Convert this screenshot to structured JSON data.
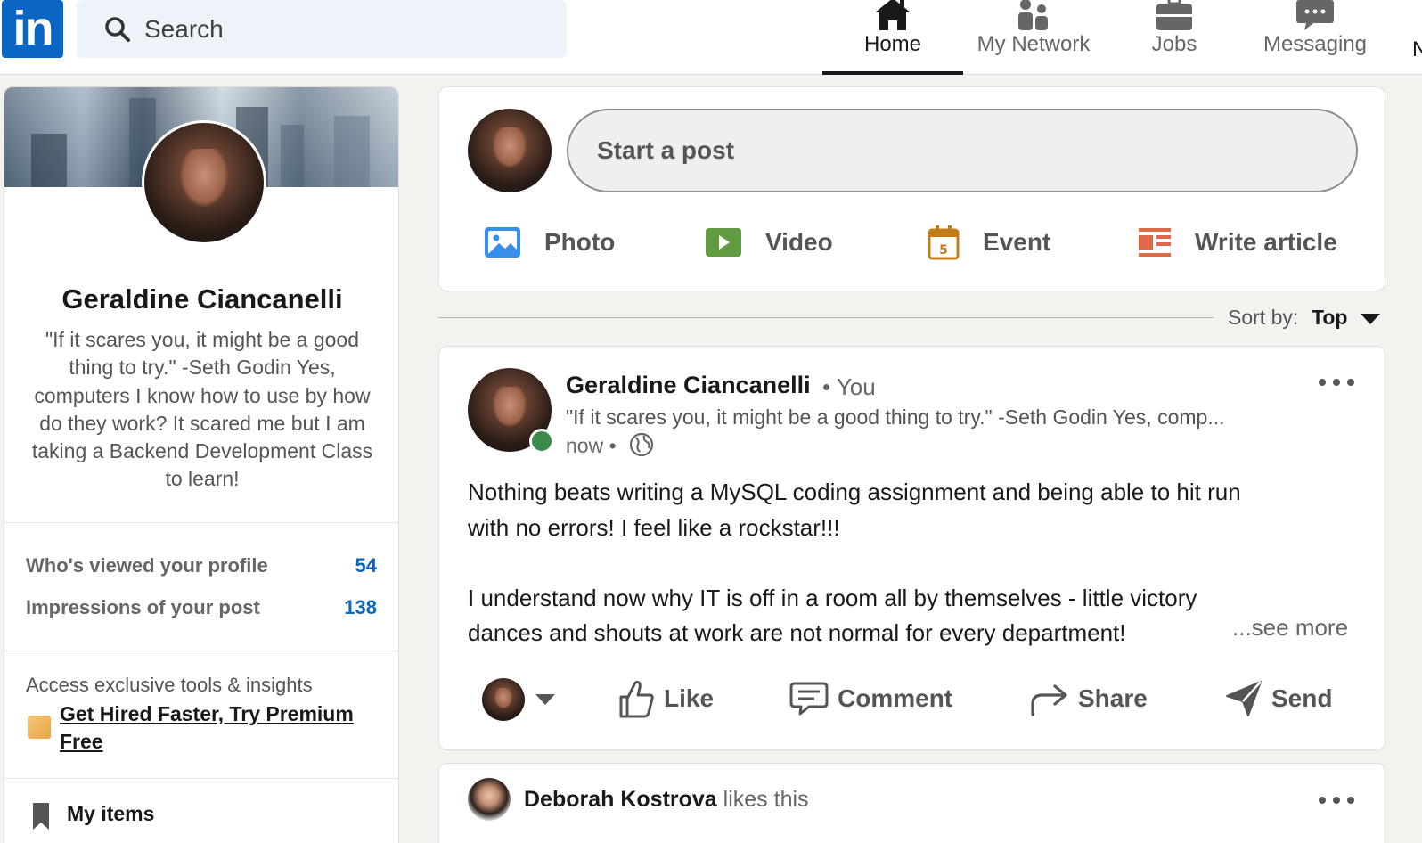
{
  "header": {
    "logo_text": "in",
    "search_placeholder": "Search",
    "nav": [
      {
        "label": "Home",
        "icon": "home-icon",
        "active": true
      },
      {
        "label": "My Network",
        "icon": "network-icon"
      },
      {
        "label": "Jobs",
        "icon": "briefcase-icon"
      },
      {
        "label": "Messaging",
        "icon": "chat-bubble-icon"
      }
    ],
    "nav_overflow": "N"
  },
  "profile": {
    "name": "Geraldine Ciancanelli",
    "headline": "\"If it scares you, it might be a good thing to try.\" -Seth Godin Yes, computers I know how to use by how do they work? It scared me but I am taking a Backend Development Class to learn!",
    "stats": [
      {
        "label": "Who's viewed your profile",
        "value": "54"
      },
      {
        "label": "Impressions of your post",
        "value": "138"
      }
    ],
    "premium_note": "Access exclusive tools & insights",
    "premium_link": "Get Hired Faster, Try Premium Free",
    "my_items": "My items"
  },
  "composer": {
    "placeholder": "Start a post",
    "actions": [
      {
        "label": "Photo",
        "icon": "photo-icon",
        "color": "#378fe9"
      },
      {
        "label": "Video",
        "icon": "video-icon",
        "color": "#5f9b41"
      },
      {
        "label": "Event",
        "icon": "calendar-icon",
        "color": "#c37d16",
        "badge": "5"
      },
      {
        "label": "Write article",
        "icon": "article-icon",
        "color": "#e06847"
      }
    ]
  },
  "sort": {
    "label": "Sort by:",
    "value": "Top"
  },
  "post": {
    "author": "Geraldine Ciancanelli",
    "relation": "• You",
    "headline": "\"If it scares you, it might be a good thing to try.\" -Seth Godin Yes, comp...",
    "time": "now •",
    "body": [
      "Nothing beats writing a MySQL coding assignment and being able to hit run",
      "with no errors! I feel like a rockstar!!!",
      "I understand now why IT is off in a room all by themselves - little victory",
      "dances and shouts at work are not normal for every department!"
    ],
    "see_more": "...see more",
    "actions": [
      "Like",
      "Comment",
      "Share",
      "Send"
    ]
  },
  "next_post": {
    "name": "Deborah Kostrova",
    "text": "likes this"
  },
  "colors": {
    "brand": "#0a66c2",
    "background": "#f4f2ee",
    "online": "#3c8a4a"
  }
}
